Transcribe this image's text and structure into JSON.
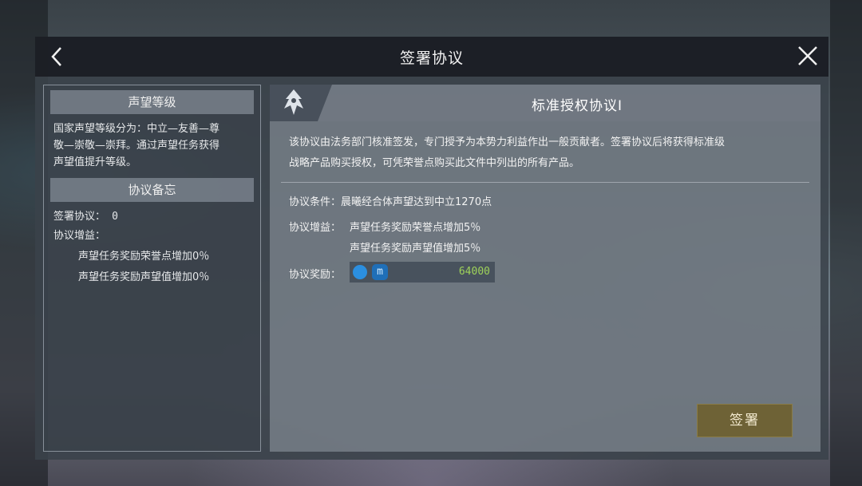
{
  "header": {
    "title": "签署协议",
    "back_icon": "chevron-left-icon",
    "close_icon": "close-icon"
  },
  "left": {
    "reputation_heading": "声望等级",
    "reputation_lines": [
      "国家声望等级分为：中立—友善—尊",
      "敬—崇敬—崇拜。通过声望任务获得",
      "声望值提升等级。"
    ],
    "memo_heading": "协议备忘",
    "signed_label": "签署协议：",
    "signed_value": "0",
    "gain_label": "协议增益：",
    "gain_lines": [
      "声望任务奖励荣誉点增加0％",
      "声望任务奖励声望值增加0％"
    ]
  },
  "agreement": {
    "emblem_icon": "faction-emblem-icon",
    "title": "标准授权协议I",
    "description_lines": [
      "该协议由法务部门核准签发，专门授予为本势力利益作出一般贡献者。签署协议后将获得标准级",
      "战略产品购买授权，可凭荣誉点购买此文件中列出的所有产品。"
    ],
    "condition_label": "协议条件：",
    "condition_value": "晨曦经合体声望达到中立1270点",
    "gain_label": "协议增益：",
    "gain_lines": [
      "声望任务奖励荣誉点增加5％",
      "声望任务奖励声望值增加5％"
    ],
    "reward_label": "协议奖励：",
    "reward_icons": [
      "coin-icon",
      "m-currency-icon"
    ],
    "reward_m": "m",
    "reward_value": "64000",
    "reward_value_color": "#9fd35a",
    "sign_button": "签署",
    "sign_button_color": "#6e6236"
  }
}
